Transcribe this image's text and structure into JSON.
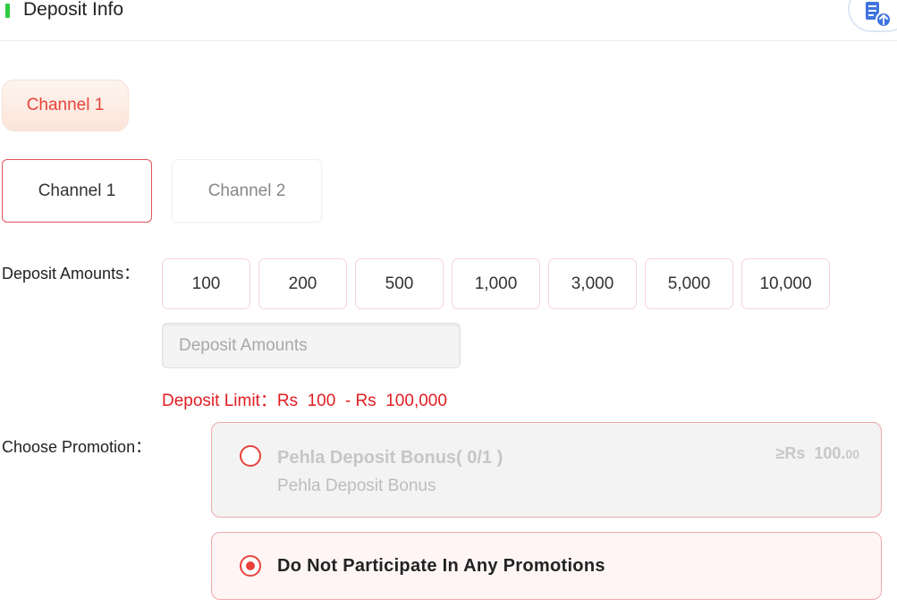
{
  "header": {
    "title": "Deposit Info",
    "accent_color": "#2ecc40",
    "history_icon": "document-upload-icon"
  },
  "channel_tab": {
    "label": "Channel 1"
  },
  "channels": [
    {
      "label": "Channel 1",
      "selected": true
    },
    {
      "label": "Channel 2",
      "selected": false
    }
  ],
  "deposit": {
    "label": "Deposit Amounts：",
    "amounts": [
      "100",
      "200",
      "500",
      "1,000",
      "3,000",
      "5,000",
      "10,000"
    ],
    "input_placeholder": "Deposit Amounts",
    "input_value": "",
    "limit_text": "Deposit Limit：Rs  100  - Rs  100,000"
  },
  "promotion": {
    "label": "Choose Promotion：",
    "options": [
      {
        "name": "Pehla Deposit Bonus( 0/1 )",
        "description": "Pehla Deposit Bonus",
        "min_prefix": "≥Rs  ",
        "min_value": "100.",
        "min_cents": "00",
        "selected": false,
        "disabled": true
      },
      {
        "name": "Do Not Participate In Any Promotions",
        "selected": true,
        "disabled": false
      }
    ]
  },
  "colors": {
    "brand_red": "#e8423a",
    "limit_red": "#e11d22",
    "border_pink": "#f0a8ac"
  }
}
